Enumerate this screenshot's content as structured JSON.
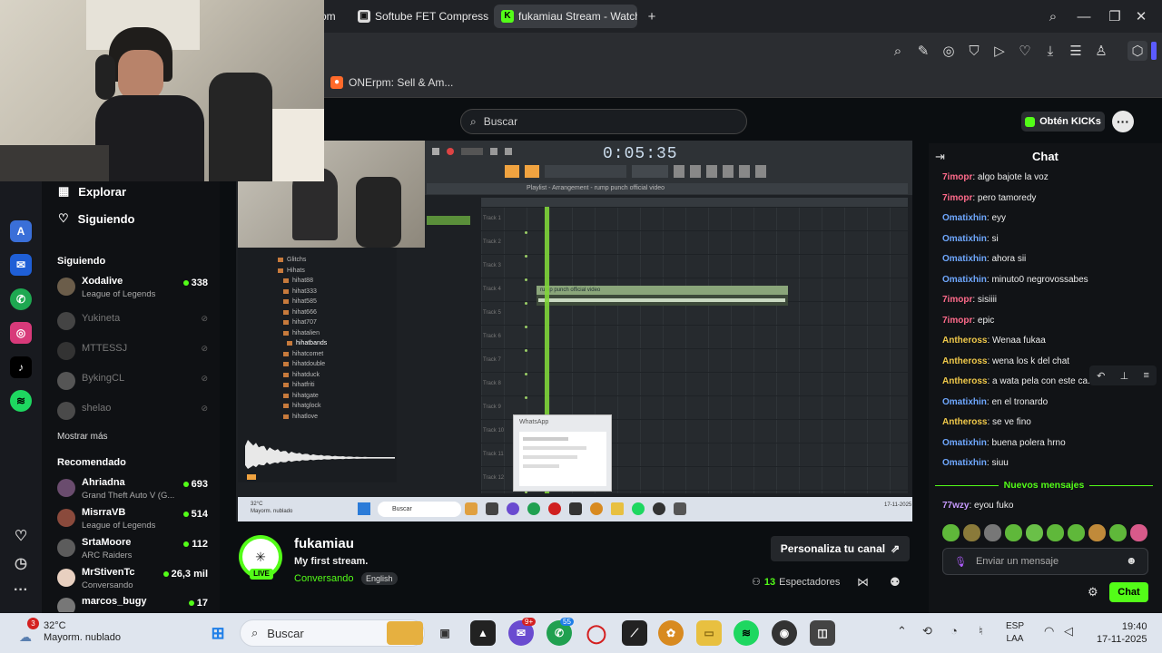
{
  "browser": {
    "tabs": [
      {
        "label": "om",
        "icon": "generic-icon",
        "active": false
      },
      {
        "label": "Softube FET Compressor",
        "icon": "softube-icon",
        "active": false
      },
      {
        "label": "fukamiau Stream - Watch",
        "icon": "kick-icon",
        "active": true
      }
    ],
    "bookmark": "ONErpm: Sell & Am..."
  },
  "site": {
    "search_placeholder": "Buscar",
    "kicks_button": "Obtén KICKs",
    "nav": {
      "explore": "Explorar",
      "following": "Siguiendo"
    },
    "following_header": "Siguiendo",
    "following": [
      {
        "name": "Xodalive",
        "game": "League of Legends",
        "viewers": "338",
        "live": true
      },
      {
        "name": "Yukineta",
        "live": false
      },
      {
        "name": "MTTESSJ",
        "live": false
      },
      {
        "name": "BykingCL",
        "live": false
      },
      {
        "name": "shelao",
        "live": false
      }
    ],
    "show_more": "Mostrar más",
    "recommended_header": "Recomendado",
    "recommended": [
      {
        "name": "Ahriadna",
        "game": "Grand Theft Auto V (G...",
        "viewers": "693"
      },
      {
        "name": "MisrraVB",
        "game": "League of Legends",
        "viewers": "514"
      },
      {
        "name": "SrtaMoore",
        "game": "ARC Raiders",
        "viewers": "112"
      },
      {
        "name": "MrStivenTc",
        "game": "Conversando",
        "viewers": "26,3 mil"
      },
      {
        "name": "marcos_bugy",
        "game": "",
        "viewers": "17"
      }
    ]
  },
  "video": {
    "timer": "0:05:35",
    "playlist_title": "Playlist - Arrangement - rump punch official video",
    "clip_label": "rump punch official video",
    "browser_items": [
      "Glitchs",
      "Hihats",
      "hihat88",
      "hihat333",
      "hihat585",
      "hihat666",
      "hihat707",
      "hihatalien",
      "hihatbands",
      "hihatcomet",
      "hihatdouble",
      "hihatduck",
      "hihatfriti",
      "hihatgate",
      "hihatglock",
      "hihatlove"
    ],
    "tracks": [
      "Track 1",
      "Track 2",
      "Track 3",
      "Track 4",
      "Track 5",
      "Track 6",
      "Track 7",
      "Track 8",
      "Track 9",
      "Track 10",
      "Track 11",
      "Track 12"
    ],
    "popup": "WhatsApp",
    "inner_weather": "32°C",
    "inner_weather_desc": "Mayorm. nublado",
    "inner_search": "Buscar",
    "inner_date": "17-11-2025"
  },
  "stream": {
    "channel": "fukamiau",
    "title": "My first stream.",
    "category": "Conversando",
    "language": "English",
    "live_badge": "LIVE",
    "customize": "Personaliza tu canal",
    "viewers": "13",
    "viewers_label": "Espectadores"
  },
  "chat": {
    "title": "Chat",
    "messages": [
      {
        "user": "7imopr",
        "text": "algo bajote la voz",
        "color": "#ff6b8b"
      },
      {
        "user": "7imopr",
        "text": "pero tamoredy",
        "color": "#ff6b8b"
      },
      {
        "user": "Omatixhin",
        "text": "eyy",
        "color": "#6fa8ff"
      },
      {
        "user": "Omatixhin",
        "text": "si",
        "color": "#6fa8ff"
      },
      {
        "user": "Omatixhin",
        "text": "ahora sii",
        "color": "#6fa8ff"
      },
      {
        "user": "Omatixhin",
        "text": "minuto0 negrovossabes",
        "color": "#6fa8ff"
      },
      {
        "user": "7imopr",
        "text": "sisiiii",
        "color": "#ff6b8b"
      },
      {
        "user": "7imopr",
        "text": "epic",
        "color": "#ff6b8b"
      },
      {
        "user": "Antheross",
        "text": "Wenaa fukaa",
        "color": "#f0c94a"
      },
      {
        "user": "Antheross",
        "text": "wena los k del chat",
        "color": "#f0c94a"
      },
      {
        "user": "Antheross",
        "text": "a wata pela con este ca...",
        "color": "#f0c94a"
      },
      {
        "user": "Omatixhin",
        "text": "en el tronardo",
        "color": "#6fa8ff"
      },
      {
        "user": "Antheross",
        "text": "se ve fino",
        "color": "#f0c94a"
      },
      {
        "user": "Omatixhin",
        "text": "buena polera hrno",
        "color": "#6fa8ff"
      },
      {
        "user": "Omatixhin",
        "text": "siuu",
        "color": "#6fa8ff"
      }
    ],
    "new_messages": "Nuevos mensajes",
    "after": {
      "user": "77wzy",
      "text": "eyou fuko",
      "color": "#c89bff"
    },
    "input_placeholder": "Enviar un mensaje",
    "send": "Chat"
  },
  "taskbar": {
    "weather_temp": "32°C",
    "weather_desc": "Mayorm. nublado",
    "weather_badge": "3",
    "search": "Buscar",
    "messenger_badge": "9+",
    "whatsapp_badge": "55",
    "lang": "ESP",
    "region": "LAA",
    "time": "19:40",
    "date": "17-11-2025"
  }
}
